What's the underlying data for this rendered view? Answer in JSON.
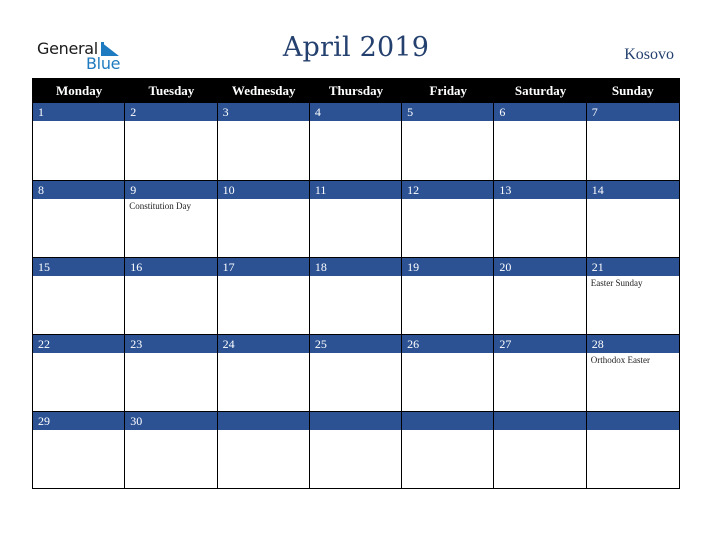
{
  "logo": {
    "word1": "General",
    "word2": "Blue"
  },
  "header": {
    "title": "April 2019",
    "country": "Kosovo"
  },
  "weekdays": [
    "Monday",
    "Tuesday",
    "Wednesday",
    "Thursday",
    "Friday",
    "Saturday",
    "Sunday"
  ],
  "weeks": [
    [
      {
        "day": "1",
        "event": ""
      },
      {
        "day": "2",
        "event": ""
      },
      {
        "day": "3",
        "event": ""
      },
      {
        "day": "4",
        "event": ""
      },
      {
        "day": "5",
        "event": ""
      },
      {
        "day": "6",
        "event": ""
      },
      {
        "day": "7",
        "event": ""
      }
    ],
    [
      {
        "day": "8",
        "event": ""
      },
      {
        "day": "9",
        "event": "Constitution Day"
      },
      {
        "day": "10",
        "event": ""
      },
      {
        "day": "11",
        "event": ""
      },
      {
        "day": "12",
        "event": ""
      },
      {
        "day": "13",
        "event": ""
      },
      {
        "day": "14",
        "event": ""
      }
    ],
    [
      {
        "day": "15",
        "event": ""
      },
      {
        "day": "16",
        "event": ""
      },
      {
        "day": "17",
        "event": ""
      },
      {
        "day": "18",
        "event": ""
      },
      {
        "day": "19",
        "event": ""
      },
      {
        "day": "20",
        "event": ""
      },
      {
        "day": "21",
        "event": "Easter Sunday"
      }
    ],
    [
      {
        "day": "22",
        "event": ""
      },
      {
        "day": "23",
        "event": ""
      },
      {
        "day": "24",
        "event": ""
      },
      {
        "day": "25",
        "event": ""
      },
      {
        "day": "26",
        "event": ""
      },
      {
        "day": "27",
        "event": ""
      },
      {
        "day": "28",
        "event": "Orthodox Easter"
      }
    ],
    [
      {
        "day": "29",
        "event": ""
      },
      {
        "day": "30",
        "event": ""
      },
      {
        "day": "",
        "event": ""
      },
      {
        "day": "",
        "event": ""
      },
      {
        "day": "",
        "event": ""
      },
      {
        "day": "",
        "event": ""
      },
      {
        "day": "",
        "event": ""
      }
    ]
  ],
  "colors": {
    "header_bg": "#000000",
    "day_bar": "#2c5294",
    "title": "#24406e",
    "logo_blue": "#1f7bc0"
  }
}
